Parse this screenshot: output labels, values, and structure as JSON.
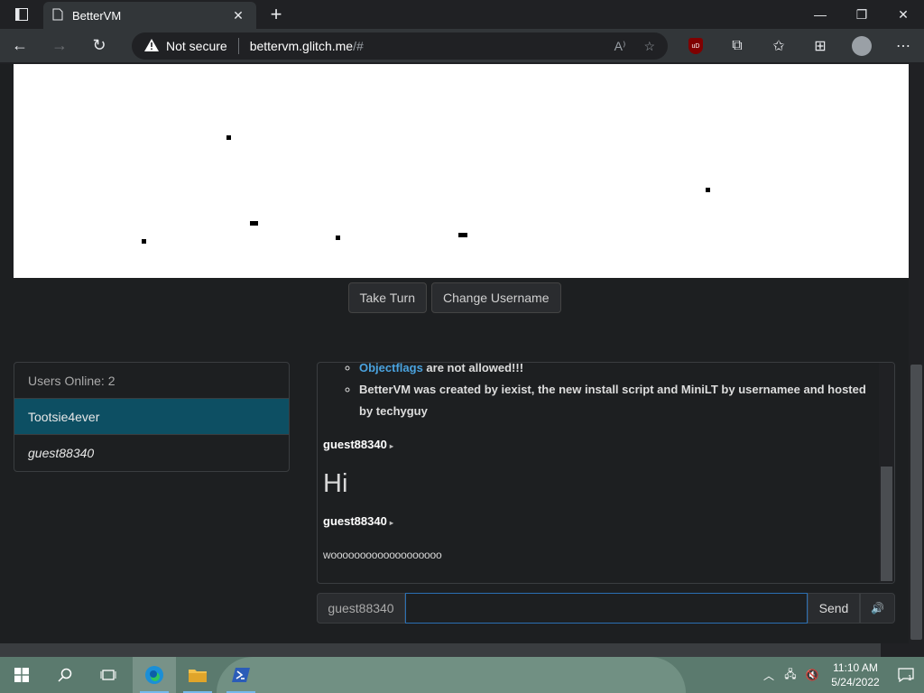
{
  "browser": {
    "tab_title": "BetterVM",
    "security_label": "Not secure",
    "url_main": "bettervm.glitch.me",
    "url_suffix": "/#"
  },
  "vm": {
    "take_turn_label": "Take Turn",
    "change_username_label": "Change Username"
  },
  "users": {
    "header": "Users Online: 2",
    "list": [
      "Tootsie4ever",
      "guest88340"
    ]
  },
  "chat": {
    "rules": [
      {
        "link": "Objectflags",
        "text": " are not allowed!!!"
      },
      {
        "text": "BetterVM was created by iexist, the new install script and MiniLT by usernamee and hosted by techyguy"
      }
    ],
    "messages": [
      {
        "user": "guest88340",
        "text": "Hi",
        "style": "big"
      },
      {
        "user": "guest88340",
        "text": "wooooooooooooooooooo",
        "style": "small"
      }
    ]
  },
  "input": {
    "username": "guest88340",
    "value": "",
    "send_label": "Send"
  },
  "taskbar": {
    "time": "11:10 AM",
    "date": "5/24/2022",
    "notification_count": "1"
  },
  "colors": {
    "active_user_bg": "#0d4f63",
    "link": "#4aa3df",
    "input_focus": "#2b6fb3"
  }
}
